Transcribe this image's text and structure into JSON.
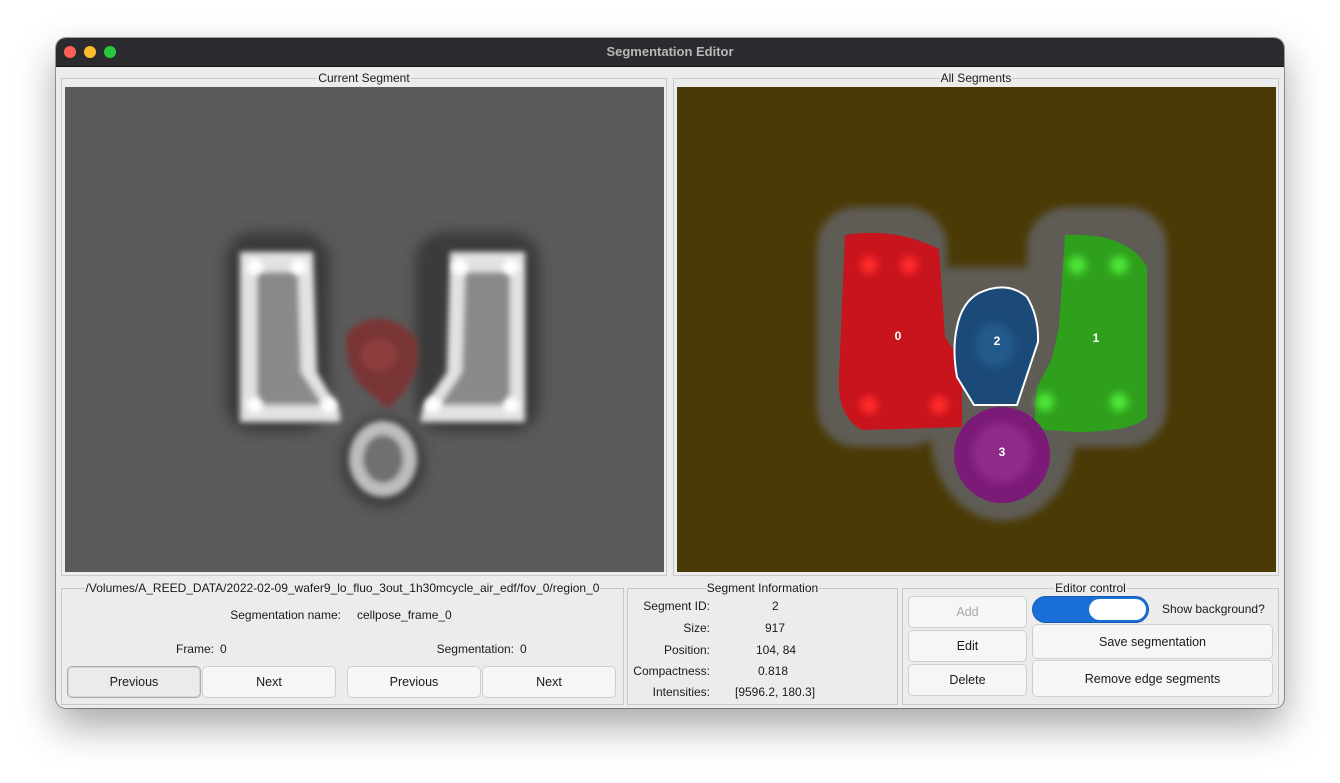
{
  "window": {
    "title": "Segmentation Editor"
  },
  "current_segment": {
    "title": "Current Segment"
  },
  "all_segments": {
    "title": "All Segments",
    "labels": [
      "0",
      "2",
      "1",
      "3"
    ],
    "colors": {
      "background": "#4a3a06",
      "segment_0": "#c8141c",
      "segment_1": "#2fa01c",
      "segment_2": "#1b4a78",
      "segment_3": "#7c1a78"
    }
  },
  "file": {
    "path": "/Volumes/A_REED_DATA/2022-02-09_wafer9_lo_fluo_3out_1h30mcycle_air_edf/fov_0/region_0",
    "segmentation_name_label": "Segmentation name:",
    "segmentation_name_value": "cellpose_frame_0",
    "frame_label": "Frame:",
    "frame_value": "0",
    "segmentation_label": "Segmentation:",
    "segmentation_value": "0",
    "frame_previous": "Previous",
    "frame_next": "Next",
    "seg_previous": "Previous",
    "seg_next": "Next"
  },
  "segment_info": {
    "title": "Segment Information",
    "id_label": "Segment ID:",
    "id_value": "2",
    "size_label": "Size:",
    "size_value": "917",
    "position_label": "Position:",
    "position_value": "104, 84",
    "compactness_label": "Compactness:",
    "compactness_value": "0.818",
    "intensities_label": "Intensities:",
    "intensities_value": "[9596.2, 180.3]"
  },
  "editor_control": {
    "title": "Editor control",
    "add": "Add",
    "edit": "Edit",
    "delete": "Delete",
    "show_background_label": "Show background?",
    "show_background_on": true,
    "save": "Save segmentation",
    "remove_edge": "Remove edge segments"
  }
}
